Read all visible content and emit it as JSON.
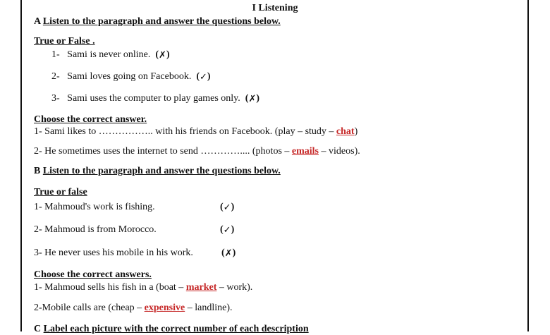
{
  "title": "I Listening",
  "sectionA": {
    "letter": "A",
    "heading": "Listen to the paragraph and answer the questions below.",
    "tf_heading": "True or False .",
    "tf_items": [
      {
        "num": "1-",
        "text": "Sami is never online.",
        "mark": "✗"
      },
      {
        "num": "2-",
        "text": "Sami loves going on Facebook.",
        "mark": "✓"
      },
      {
        "num": "3-",
        "text": "Sami uses the computer to play games only.",
        "mark": "✗"
      }
    ],
    "choose_heading": "Choose the correct answer.",
    "choose_items": [
      {
        "pre": "1- Sami likes to …………….. with his friends on Facebook. (play  –  study  – ",
        "answer": "chat",
        "post": ")"
      },
      {
        "pre": "2- He sometimes uses the internet to send ………….... (photos – ",
        "answer": "emails",
        "post": " – videos)."
      }
    ]
  },
  "sectionB": {
    "letter": "B",
    "heading": "Listen to the paragraph and answer the questions below.",
    "tf_heading": "True  or false",
    "tf_items": [
      {
        "text": "1- Mahmoud's work is fishing.",
        "mark": "✓"
      },
      {
        "text": "2- Mahmoud is from Morocco.",
        "mark": "✓"
      },
      {
        "text": "3- He never uses his mobile in his work.",
        "mark": "✗"
      }
    ],
    "choose_heading": "Choose the correct answers.",
    "choose_items": [
      {
        "pre": "1- Mahmoud sells his fish in a (boat  – ",
        "answer": "market",
        "post": "  – work)."
      },
      {
        "pre": "2-Mobile calls are (cheap – ",
        "answer": "expensive",
        "post": " – landline)."
      }
    ]
  },
  "sectionC": {
    "letter": "C",
    "heading": "Label each picture with the correct number of each description"
  },
  "colors": {
    "answer": "#c62828",
    "text": "#111111"
  }
}
